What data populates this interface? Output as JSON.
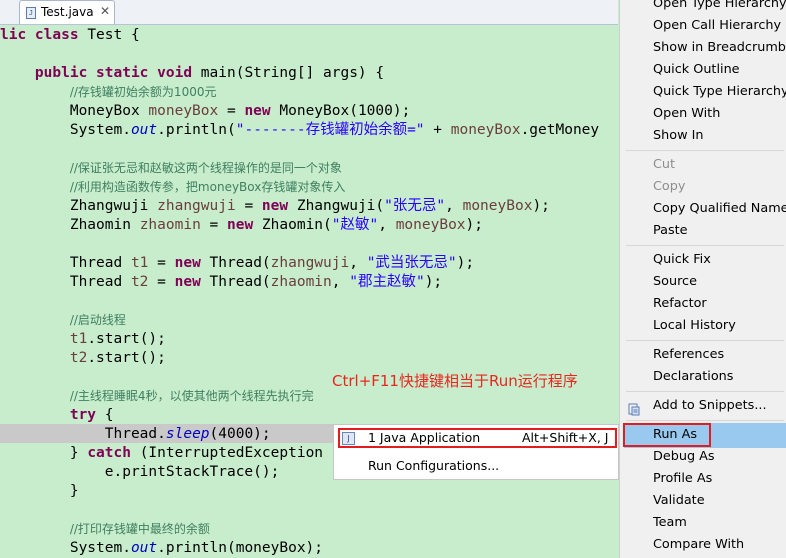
{
  "tab": {
    "title": "Test.java",
    "close": "✕",
    "icon": "java-file-icon"
  },
  "code": {
    "lines": [
      [
        {
          "t": "kw",
          "v": "lic class "
        },
        {
          "t": "plain",
          "v": "Test {"
        }
      ],
      [],
      [
        {
          "t": "plain",
          "v": "    "
        },
        {
          "t": "kw",
          "v": "public static void "
        },
        {
          "t": "plain",
          "v": "main(String[] args) {"
        }
      ],
      [
        {
          "t": "plain",
          "v": "        "
        },
        {
          "t": "cmt",
          "v": "//存钱罐初始余额为1000元"
        }
      ],
      [
        {
          "t": "plain",
          "v": "        MoneyBox "
        },
        {
          "t": "loc",
          "v": "moneyBox"
        },
        {
          "t": "plain",
          "v": " = "
        },
        {
          "t": "kw",
          "v": "new "
        },
        {
          "t": "plain",
          "v": "MoneyBox(1000);"
        }
      ],
      [
        {
          "t": "plain",
          "v": "        System."
        },
        {
          "t": "fld",
          "v": "out"
        },
        {
          "t": "plain",
          "v": ".println("
        },
        {
          "t": "str",
          "v": "\"-------存钱罐初始余额=\""
        },
        {
          "t": "plain",
          "v": " + "
        },
        {
          "t": "loc",
          "v": "moneyBox"
        },
        {
          "t": "plain",
          "v": ".getMoney"
        }
      ],
      [],
      [
        {
          "t": "plain",
          "v": "        "
        },
        {
          "t": "cmt",
          "v": "//保证张无忌和赵敏这两个线程操作的是同一个对象"
        }
      ],
      [
        {
          "t": "plain",
          "v": "        "
        },
        {
          "t": "cmt",
          "v": "//利用构造函数传参，把moneyBox存钱罐对象传入"
        }
      ],
      [
        {
          "t": "plain",
          "v": "        Zhangwuji "
        },
        {
          "t": "loc",
          "v": "zhangwuji"
        },
        {
          "t": "plain",
          "v": " = "
        },
        {
          "t": "kw",
          "v": "new "
        },
        {
          "t": "plain",
          "v": "Zhangwuji("
        },
        {
          "t": "str",
          "v": "\"张无忌\""
        },
        {
          "t": "plain",
          "v": ", "
        },
        {
          "t": "loc",
          "v": "moneyBox"
        },
        {
          "t": "plain",
          "v": ");"
        }
      ],
      [
        {
          "t": "plain",
          "v": "        Zhaomin "
        },
        {
          "t": "loc",
          "v": "zhaomin"
        },
        {
          "t": "plain",
          "v": " = "
        },
        {
          "t": "kw",
          "v": "new "
        },
        {
          "t": "plain",
          "v": "Zhaomin("
        },
        {
          "t": "str",
          "v": "\"赵敏\""
        },
        {
          "t": "plain",
          "v": ", "
        },
        {
          "t": "loc",
          "v": "moneyBox"
        },
        {
          "t": "plain",
          "v": ");"
        }
      ],
      [],
      [
        {
          "t": "plain",
          "v": "        Thread "
        },
        {
          "t": "loc",
          "v": "t1"
        },
        {
          "t": "plain",
          "v": " = "
        },
        {
          "t": "kw",
          "v": "new "
        },
        {
          "t": "plain",
          "v": "Thread("
        },
        {
          "t": "loc",
          "v": "zhangwuji"
        },
        {
          "t": "plain",
          "v": ", "
        },
        {
          "t": "str",
          "v": "\"武当张无忌\""
        },
        {
          "t": "plain",
          "v": ");"
        }
      ],
      [
        {
          "t": "plain",
          "v": "        Thread "
        },
        {
          "t": "loc",
          "v": "t2"
        },
        {
          "t": "plain",
          "v": " = "
        },
        {
          "t": "kw",
          "v": "new "
        },
        {
          "t": "plain",
          "v": "Thread("
        },
        {
          "t": "loc",
          "v": "zhaomin"
        },
        {
          "t": "plain",
          "v": ", "
        },
        {
          "t": "str",
          "v": "\"郡主赵敏\""
        },
        {
          "t": "plain",
          "v": ");"
        }
      ],
      [],
      [
        {
          "t": "plain",
          "v": "        "
        },
        {
          "t": "cmt",
          "v": "//启动线程"
        }
      ],
      [
        {
          "t": "plain",
          "v": "        "
        },
        {
          "t": "loc",
          "v": "t1"
        },
        {
          "t": "plain",
          "v": ".start();"
        }
      ],
      [
        {
          "t": "plain",
          "v": "        "
        },
        {
          "t": "loc",
          "v": "t2"
        },
        {
          "t": "plain",
          "v": ".start();"
        }
      ],
      [],
      [
        {
          "t": "plain",
          "v": "        "
        },
        {
          "t": "cmt",
          "v": "//主线程睡眠4秒，以使其他两个线程先执行完"
        }
      ],
      [
        {
          "t": "plain",
          "v": "        "
        },
        {
          "t": "kw",
          "v": "try "
        },
        {
          "t": "plain",
          "v": "{"
        }
      ],
      [
        {
          "t": "plain",
          "v": "            Thread."
        },
        {
          "t": "fld",
          "v": "sleep"
        },
        {
          "t": "plain",
          "v": "(4000);"
        }
      ],
      [
        {
          "t": "plain",
          "v": "        } "
        },
        {
          "t": "kw",
          "v": "catch "
        },
        {
          "t": "plain",
          "v": "(InterruptedException"
        }
      ],
      [
        {
          "t": "plain",
          "v": "            e.printStackTrace();"
        }
      ],
      [
        {
          "t": "plain",
          "v": "        }"
        }
      ],
      [],
      [
        {
          "t": "plain",
          "v": "        "
        },
        {
          "t": "cmt",
          "v": "//打印存钱罐中最终的余额"
        }
      ],
      [
        {
          "t": "plain",
          "v": "        System."
        },
        {
          "t": "fld",
          "v": "out"
        },
        {
          "t": "plain",
          "v": ".println(moneyBox);"
        }
      ]
    ]
  },
  "annotation": "Ctrl+F11快捷键相当于Run运行程序",
  "popup": {
    "item1_label": "1 Java Application",
    "item1_shortcut": "Alt+Shift+X, J",
    "item1_icon": "J",
    "item2_label": "Run Configurations..."
  },
  "menu": {
    "items": [
      {
        "label": "Open Type Hierarchy",
        "enabled": true
      },
      {
        "label": "Open Call Hierarchy",
        "enabled": true
      },
      {
        "label": "Show in Breadcrumb",
        "enabled": true
      },
      {
        "label": "Quick Outline",
        "enabled": true
      },
      {
        "label": "Quick Type Hierarchy",
        "enabled": true
      },
      {
        "label": "Open With",
        "enabled": true
      },
      {
        "label": "Show In",
        "enabled": true
      },
      {
        "label": "Cut",
        "enabled": false
      },
      {
        "label": "Copy",
        "enabled": false
      },
      {
        "label": "Copy Qualified Name",
        "enabled": true
      },
      {
        "label": "Paste",
        "enabled": true
      },
      {
        "label": "Quick Fix",
        "enabled": true
      },
      {
        "label": "Source",
        "enabled": true
      },
      {
        "label": "Refactor",
        "enabled": true
      },
      {
        "label": "Local History",
        "enabled": true
      },
      {
        "label": "References",
        "enabled": true
      },
      {
        "label": "Declarations",
        "enabled": true
      },
      {
        "label": "Add to Snippets...",
        "enabled": true
      },
      {
        "label": "Run As",
        "enabled": true,
        "selected": true
      },
      {
        "label": "Debug As",
        "enabled": true
      },
      {
        "label": "Profile As",
        "enabled": true
      },
      {
        "label": "Validate",
        "enabled": true
      },
      {
        "label": "Team",
        "enabled": true
      },
      {
        "label": "Compare With",
        "enabled": true
      }
    ]
  },
  "colors": {
    "editor_bg": "#c7edcc",
    "keyword": "#7f0055",
    "string": "#2a00ff",
    "comment": "#3f7f5f",
    "highlight": "#99c9ef",
    "annotation_red": "#e8261e"
  }
}
